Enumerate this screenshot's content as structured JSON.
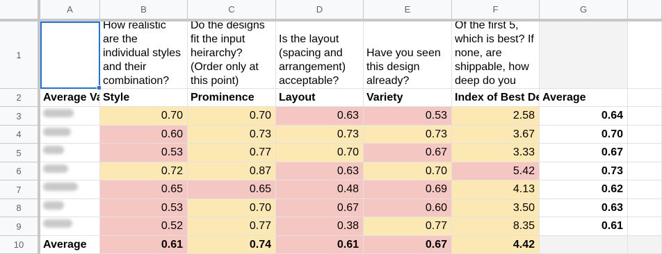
{
  "columns": [
    "A",
    "B",
    "C",
    "D",
    "E",
    "F",
    "G"
  ],
  "rows": [
    "1",
    "2",
    "3",
    "4",
    "5",
    "6",
    "7",
    "8",
    "9",
    "10"
  ],
  "row1_questions": {
    "B": "How realistic are the individual styles and their combination?",
    "C": "Do the designs fit the input heirarchy? (Order only at this point)",
    "D": "Is the layout (spacing and arrangement) acceptable?",
    "E": "Have you seen this design already?",
    "F": "Of the first 5, which is best? If none, are shippable, how deep do you"
  },
  "row2_headers": {
    "A": "Average Va",
    "B": "Style",
    "C": "Prominence",
    "D": "Layout",
    "E": "Variety",
    "F": "Index of Best De",
    "G": "Average"
  },
  "data_rows": [
    {
      "B": "0.70",
      "C": "0.70",
      "D": "0.63",
      "E": "0.53",
      "F": "2.58",
      "G": "0.64"
    },
    {
      "B": "0.60",
      "C": "0.73",
      "D": "0.73",
      "E": "0.73",
      "F": "3.67",
      "G": "0.70"
    },
    {
      "B": "0.53",
      "C": "0.77",
      "D": "0.70",
      "E": "0.67",
      "F": "3.33",
      "G": "0.67"
    },
    {
      "B": "0.72",
      "C": "0.87",
      "D": "0.63",
      "E": "0.70",
      "F": "5.42",
      "G": "0.73"
    },
    {
      "B": "0.65",
      "C": "0.65",
      "D": "0.48",
      "E": "0.69",
      "F": "4.13",
      "G": "0.62"
    },
    {
      "B": "0.53",
      "C": "0.70",
      "D": "0.67",
      "E": "0.60",
      "F": "3.50",
      "G": "0.63"
    },
    {
      "B": "0.52",
      "C": "0.77",
      "D": "0.38",
      "E": "0.77",
      "F": "8.35",
      "G": "0.61"
    }
  ],
  "average_row": {
    "A": "Average",
    "B": "0.61",
    "C": "0.74",
    "D": "0.61",
    "E": "0.67",
    "F": "4.42"
  },
  "colors": {
    "yellow_fill": "#fce8b2",
    "red_fill": "#f4c7c3",
    "selection": "#1a73e8",
    "header_bg": "#f8f9fa"
  }
}
